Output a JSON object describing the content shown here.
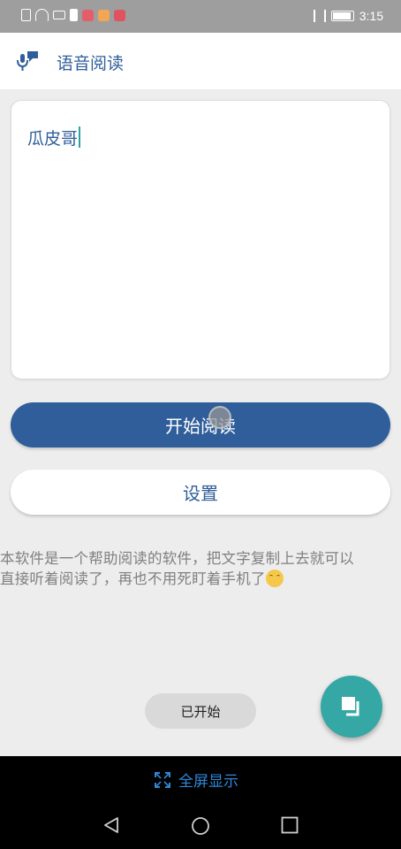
{
  "status_bar": {
    "time": "3:15",
    "icons": [
      "sim-icon",
      "wifi-icon",
      "data-icon",
      "battery-small-icon",
      "app-notify-icon",
      "app-notify-icon",
      "app-notify-icon",
      "vibrate-icon",
      "battery-icon"
    ]
  },
  "app_bar": {
    "title": "语音阅读",
    "icon": "mic-chat-icon"
  },
  "editor": {
    "text": "瓜皮哥"
  },
  "buttons": {
    "start_label": "开始阅读",
    "settings_label": "设置"
  },
  "description": {
    "line1": "本软件是一个帮助阅读的软件，把文字复制上去就可以",
    "line2": "直接听着阅读了，再也不用死盯着手机了"
  },
  "toast": {
    "text": "已开始"
  },
  "fab": {
    "icon": "copy-icon"
  },
  "bottom_bar": {
    "fullscreen_label": "全屏显示",
    "fullscreen_icon": "expand-icon"
  },
  "nav": {
    "back_icon": "back-triangle-icon",
    "home_icon": "home-circle-icon",
    "recent_icon": "recent-square-icon"
  },
  "colors": {
    "primary": "#2f5e9a",
    "accent": "#35a7a5",
    "background": "#ededed"
  }
}
